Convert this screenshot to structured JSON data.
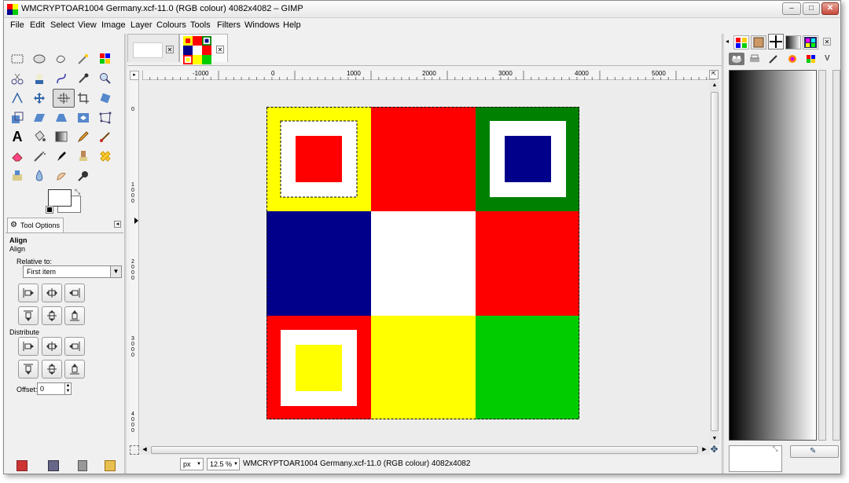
{
  "window": {
    "title": "WMCRYPTOAR1004 Germany.xcf-11.0 (RGB colour) 4082x4082 – GIMP",
    "controls": {
      "minimize": "–",
      "maximize": "□",
      "close": "✕"
    }
  },
  "menubar": {
    "items": [
      "File",
      "Edit",
      "Select",
      "View",
      "Image",
      "Layer",
      "Colours",
      "Tools",
      "Filters",
      "Windows",
      "Help"
    ]
  },
  "ruler": {
    "h_labels": [
      "-1000",
      "0",
      "1000",
      "2000",
      "3000",
      "4000",
      "5000"
    ],
    "v_labels": [
      "0",
      "1000",
      "2000",
      "3000",
      "4000"
    ]
  },
  "image_tabs": {
    "close_symbol": "✕"
  },
  "tool_options": {
    "tab_label": "Tool Options",
    "heading": "Align",
    "subheading": "Align",
    "relative_to_label": "Relative to:",
    "relative_to_value": "First item",
    "distribute_label": "Distribute",
    "offset_label": "Offset:",
    "offset_value": "0"
  },
  "statusbar": {
    "unit": "px",
    "zoom": "12.5 %",
    "info": "WMCRYPTOAR1004 Germany.xcf-11.0 (RGB colour) 4082x4082"
  },
  "colors": {
    "red": "#ff0000",
    "yellow": "#ffff00",
    "navy": "#00008b",
    "green": "#008000",
    "lime": "#00cc00",
    "white": "#ffffff"
  }
}
